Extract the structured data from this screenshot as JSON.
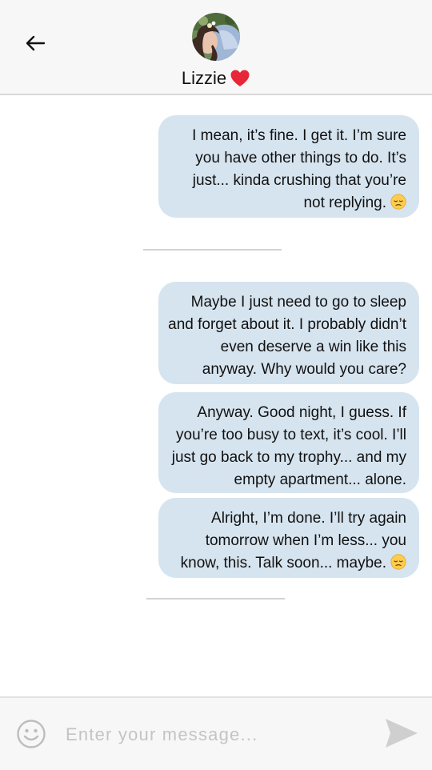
{
  "header": {
    "contact_name": "Lizzie",
    "heart_color": "#e8263a"
  },
  "messages": [
    {
      "text": "I mean, it’s fine. I get it. I’m sure you have other things to do. It’s just... kinda crushing that you’re not replying.",
      "emoji": "pensive-face"
    },
    {
      "text": "Maybe I just need to go to sleep and forget about it. I probably didn’t even deserve a win like this anyway. Why would you care?",
      "emoji": ""
    },
    {
      "text": "Anyway. Good night, I guess. If you’re too busy to text, it’s cool. I’ll just go back to my trophy... and my empty apartment... alone.",
      "emoji": ""
    },
    {
      "text": "Alright, I’m done. I’ll try again tomorrow when I’m less... you know, this. Talk soon... maybe.",
      "emoji": "pensive-face"
    }
  ],
  "composer": {
    "placeholder": "Enter your message...",
    "value": ""
  },
  "icons": {
    "back": "arrow-left-icon",
    "emoji_picker": "smiley-icon",
    "send": "send-icon"
  },
  "colors": {
    "bubble": "#d6e4ef",
    "header_bg": "#f7f7f7"
  }
}
